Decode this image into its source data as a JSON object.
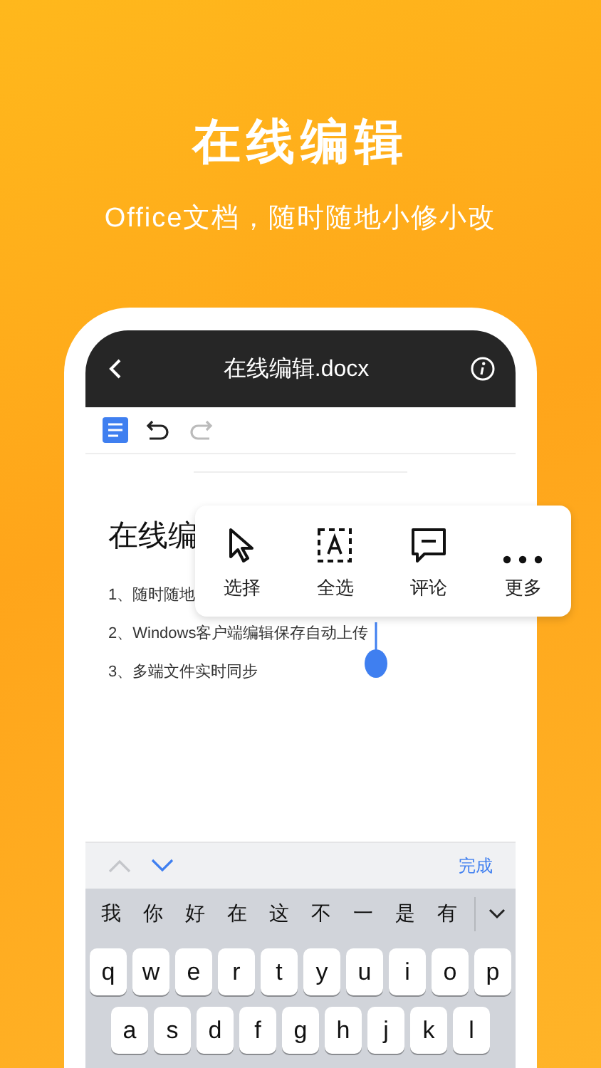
{
  "banner": {
    "title": "在线编辑",
    "subtitle": "Office文档，随时随地小修小改"
  },
  "header": {
    "title": "在线编辑.docx"
  },
  "toolbar": {
    "undo": {
      "disabled": false
    },
    "redo": {
      "disabled": true
    }
  },
  "document": {
    "heading": "在线编",
    "lines": [
      "1、随时随地",
      "2、Windows客户端编辑保存自动上传",
      "3、多端文件实时同步"
    ]
  },
  "context_menu": [
    {
      "kind": "pointer",
      "label": "选择"
    },
    {
      "kind": "select-all",
      "label": "全选"
    },
    {
      "kind": "comment",
      "label": "评论"
    },
    {
      "kind": "more",
      "label": "更多"
    }
  ],
  "accessory_bar": {
    "nav": [
      {
        "kind": "up",
        "disabled": true
      },
      {
        "kind": "down",
        "disabled": false
      }
    ],
    "done": "完成"
  },
  "keyboard": {
    "candidates": [
      "我",
      "你",
      "好",
      "在",
      "这",
      "不",
      "一",
      "是",
      "有"
    ],
    "rows": [
      [
        "q",
        "w",
        "e",
        "r",
        "t",
        "y",
        "u",
        "i",
        "o",
        "p"
      ],
      [
        "a",
        "s",
        "d",
        "f",
        "g",
        "h",
        "j",
        "k",
        "l"
      ]
    ]
  }
}
